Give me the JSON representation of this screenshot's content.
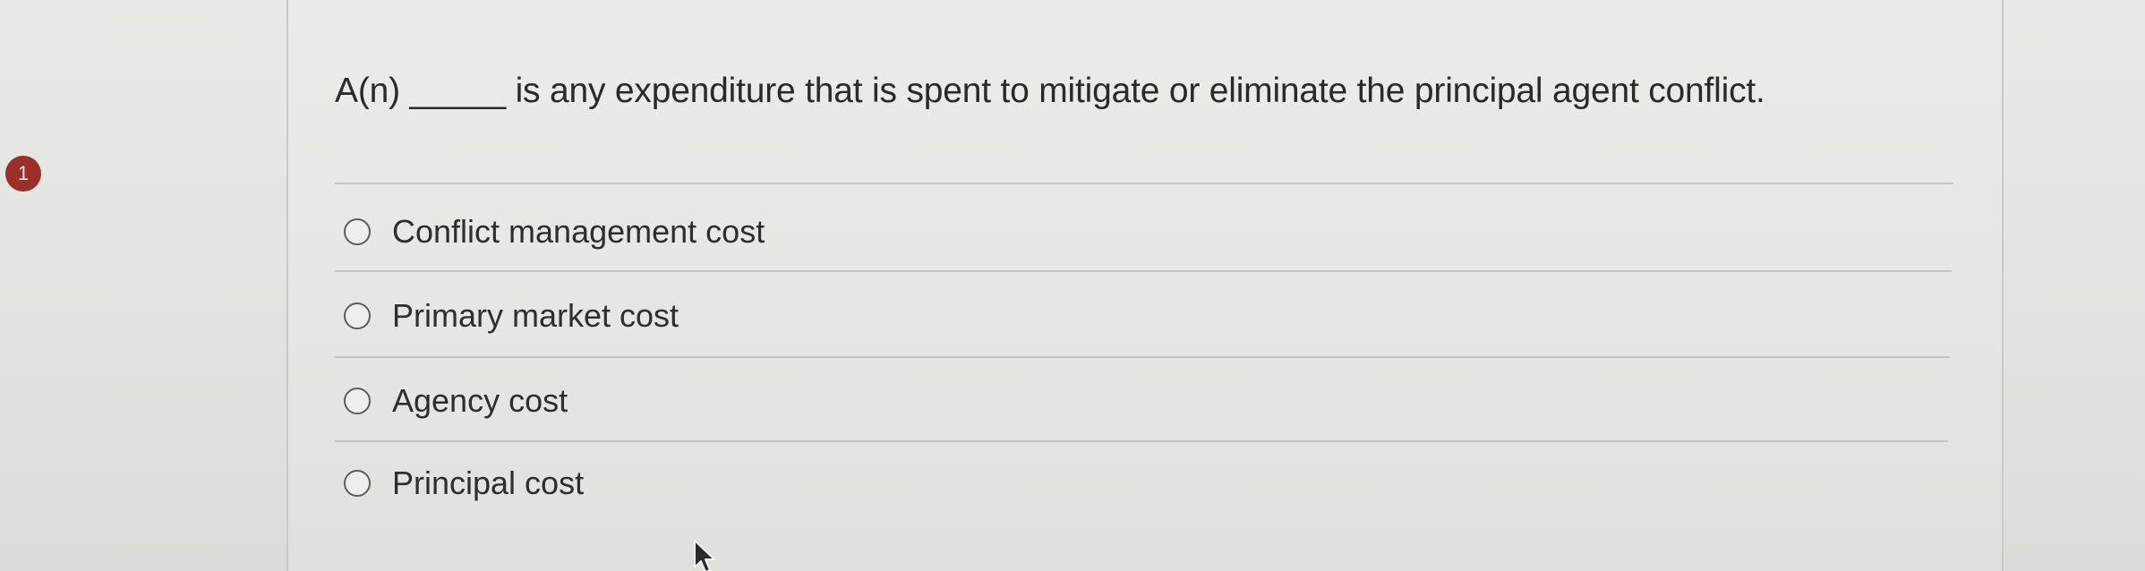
{
  "question": {
    "number": "1",
    "text": "A(n) _____ is any expenditure that is spent to mitigate or eliminate the principal agent conflict."
  },
  "options": [
    {
      "label": "Conflict management cost",
      "selected": false
    },
    {
      "label": "Primary market cost",
      "selected": false
    },
    {
      "label": "Agency cost",
      "selected": false
    },
    {
      "label": "Principal cost",
      "selected": false
    }
  ],
  "colors": {
    "badge": "#9c2f2c",
    "text": "#2a2a2a",
    "divider": "#c4c4c1"
  },
  "icons": {
    "cursor": "mouse-pointer-icon",
    "radio": "radio-button-icon"
  }
}
